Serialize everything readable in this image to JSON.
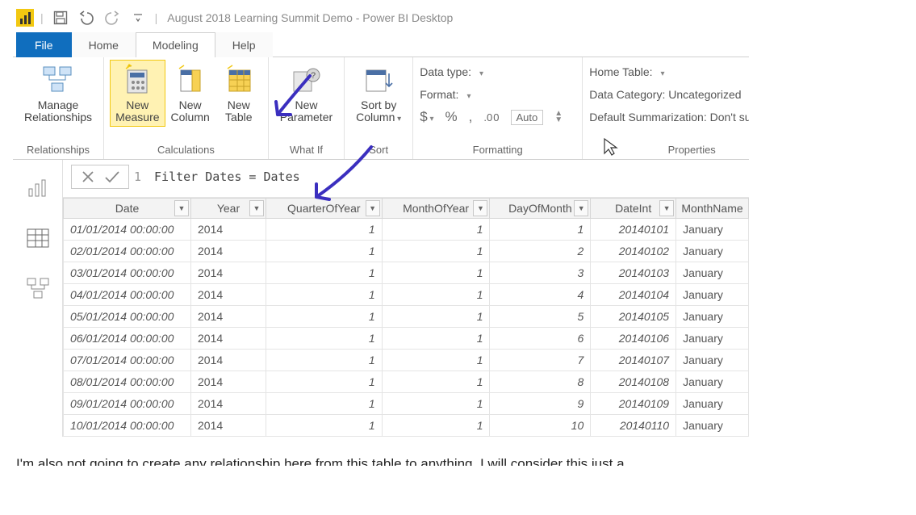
{
  "titlebar": {
    "title": "August 2018 Learning Summit Demo - Power BI Desktop"
  },
  "ribbon_tabs": {
    "file": "File",
    "home": "Home",
    "modeling": "Modeling",
    "help": "Help"
  },
  "ribbon": {
    "relationships": {
      "manage": "Manage\nRelationships",
      "group": "Relationships"
    },
    "calculations": {
      "new_measure": "New\nMeasure",
      "new_column": "New\nColumn",
      "new_table": "New\nTable",
      "group": "Calculations"
    },
    "whatif": {
      "new_parameter": "New\nParameter",
      "group": "What If"
    },
    "sort": {
      "sort_by_column": "Sort by\nColumn",
      "group": "Sort"
    },
    "formatting": {
      "data_type": "Data type:",
      "format": "Format:",
      "currency": "$",
      "percent": "%",
      "comma": ",",
      "decimals": ".0 0",
      "auto": "Auto",
      "group": "Formatting"
    },
    "properties": {
      "home_table": "Home Table:",
      "data_category": "Data Category: Uncategorized",
      "default_summarization": "Default Summarization: Don't summarize",
      "group": "Properties"
    }
  },
  "formula": {
    "line_no": "1",
    "text": "Filter Dates = Dates"
  },
  "table": {
    "headers": [
      "Date",
      "Year",
      "QuarterOfYear",
      "MonthOfYear",
      "DayOfMonth",
      "DateInt",
      "MonthName"
    ],
    "rows": [
      {
        "date": "01/01/2014 00:00:00",
        "year": "2014",
        "q": "1",
        "m": "1",
        "d": "1",
        "di": "20140101",
        "mn": "January"
      },
      {
        "date": "02/01/2014 00:00:00",
        "year": "2014",
        "q": "1",
        "m": "1",
        "d": "2",
        "di": "20140102",
        "mn": "January"
      },
      {
        "date": "03/01/2014 00:00:00",
        "year": "2014",
        "q": "1",
        "m": "1",
        "d": "3",
        "di": "20140103",
        "mn": "January"
      },
      {
        "date": "04/01/2014 00:00:00",
        "year": "2014",
        "q": "1",
        "m": "1",
        "d": "4",
        "di": "20140104",
        "mn": "January"
      },
      {
        "date": "05/01/2014 00:00:00",
        "year": "2014",
        "q": "1",
        "m": "1",
        "d": "5",
        "di": "20140105",
        "mn": "January"
      },
      {
        "date": "06/01/2014 00:00:00",
        "year": "2014",
        "q": "1",
        "m": "1",
        "d": "6",
        "di": "20140106",
        "mn": "January"
      },
      {
        "date": "07/01/2014 00:00:00",
        "year": "2014",
        "q": "1",
        "m": "1",
        "d": "7",
        "di": "20140107",
        "mn": "January"
      },
      {
        "date": "08/01/2014 00:00:00",
        "year": "2014",
        "q": "1",
        "m": "1",
        "d": "8",
        "di": "20140108",
        "mn": "January"
      },
      {
        "date": "09/01/2014 00:00:00",
        "year": "2014",
        "q": "1",
        "m": "1",
        "d": "9",
        "di": "20140109",
        "mn": "January"
      },
      {
        "date": "10/01/2014 00:00:00",
        "year": "2014",
        "q": "1",
        "m": "1",
        "d": "10",
        "di": "20140110",
        "mn": "January"
      }
    ]
  },
  "article": {
    "bottom_line": "I'm also not going to create any relationship here from this table to anything. I will consider this just a"
  }
}
